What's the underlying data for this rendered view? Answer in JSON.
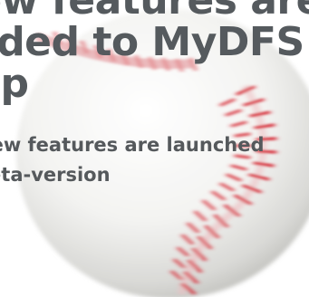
{
  "headline": {
    "line1": "New features are",
    "line2": "added to MyDFS",
    "line3": "App"
  },
  "subhead": {
    "line1": "New features are launched",
    "line2": "beta-version"
  },
  "colors": {
    "text": "#555a5e",
    "stitch": "#d8323c",
    "ball": "#f2f2f0"
  },
  "icons": {
    "ball": "baseball-icon"
  }
}
